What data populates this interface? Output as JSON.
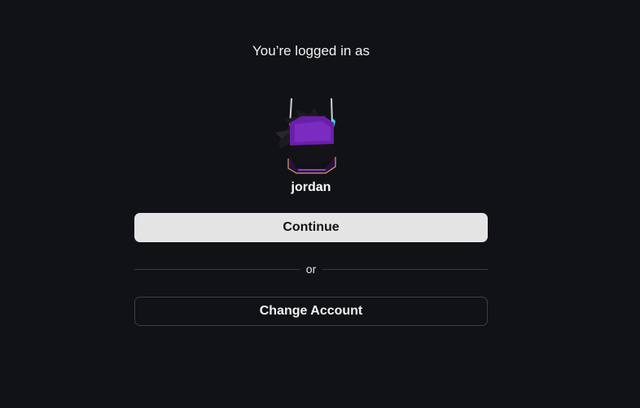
{
  "header": {
    "title": "You’re logged in as"
  },
  "account": {
    "username": "jordan",
    "avatar_icon": "user-avatar"
  },
  "actions": {
    "continue_label": "Continue",
    "divider_label": "or",
    "change_account_label": "Change Account"
  },
  "colors": {
    "background": "#111216",
    "primary_button_bg": "#e4e4e4",
    "primary_button_text": "#111216",
    "secondary_button_border": "#3d3e44",
    "avatar_accent": "#6a1fa8"
  }
}
